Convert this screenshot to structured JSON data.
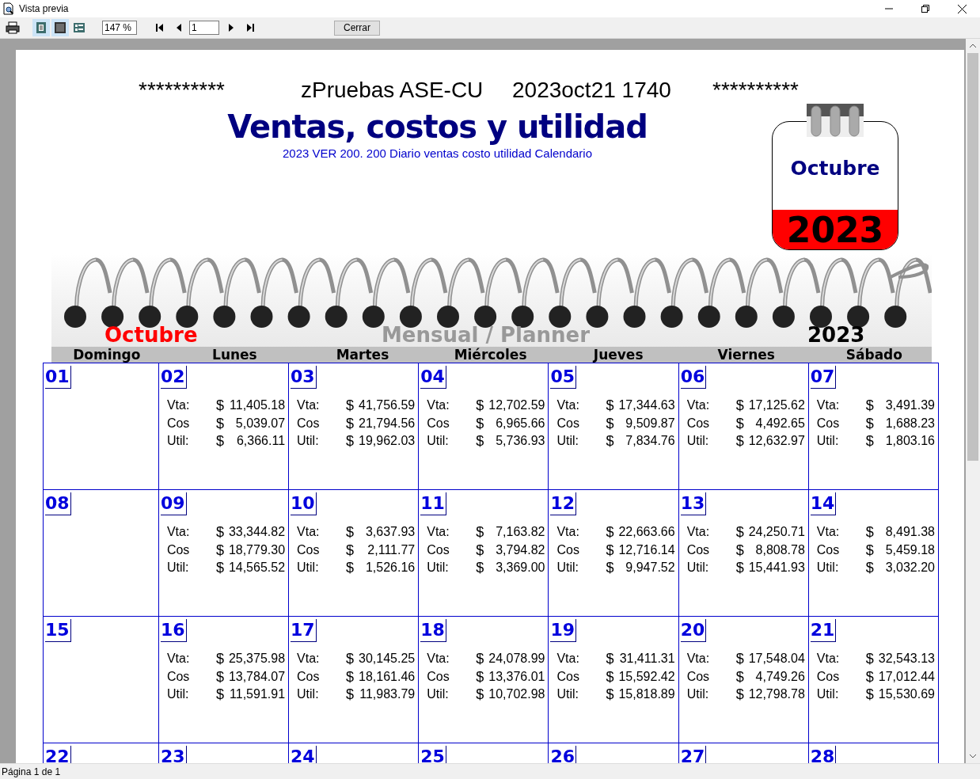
{
  "window": {
    "title": "Vista previa"
  },
  "toolbar": {
    "views": [
      {
        "selected": true
      },
      {
        "selected": true
      },
      {
        "selected": false
      }
    ],
    "zoom": "147 %",
    "page": "1",
    "close_button": "Cerrar"
  },
  "report": {
    "header": [
      "**********",
      "zPruebas ASE-CU",
      "2023oct21 1740",
      "**********"
    ],
    "title": "Ventas, costos y utilidad",
    "subtitle": "2023 VER 200. 200 Diario ventas costo utilidad Calendario",
    "badge": {
      "month": "Octubre",
      "year": "2023"
    },
    "banner": {
      "month": "Octubre",
      "subtitle": "Mensual / Planner",
      "year": "2023"
    },
    "weekdays": [
      "Domingo",
      "Lunes",
      "Martes",
      "Miércoles",
      "Jueves",
      "Viernes",
      "Sábado"
    ],
    "weeks": [
      [
        {
          "day": "01"
        },
        {
          "day": "02",
          "lines": [
            {
              "label": "Vta:",
              "currency": "$",
              "amount": "11,405.18"
            },
            {
              "label": "Cos",
              "currency": "$",
              "amount": "5,039.07"
            },
            {
              "label": "Util:",
              "currency": "$",
              "amount": "6,366.11"
            }
          ]
        },
        {
          "day": "03",
          "lines": [
            {
              "label": "Vta:",
              "currency": "$",
              "amount": "41,756.59"
            },
            {
              "label": "Cos",
              "currency": "$",
              "amount": "21,794.56"
            },
            {
              "label": "Util:",
              "currency": "$",
              "amount": "19,962.03"
            }
          ]
        },
        {
          "day": "04",
          "lines": [
            {
              "label": "Vta:",
              "currency": "$",
              "amount": "12,702.59"
            },
            {
              "label": "Cos",
              "currency": "$",
              "amount": "6,965.66"
            },
            {
              "label": "Util:",
              "currency": "$",
              "amount": "5,736.93"
            }
          ]
        },
        {
          "day": "05",
          "lines": [
            {
              "label": "Vta:",
              "currency": "$",
              "amount": "17,344.63"
            },
            {
              "label": "Cos",
              "currency": "$",
              "amount": "9,509.87"
            },
            {
              "label": "Util:",
              "currency": "$",
              "amount": "7,834.76"
            }
          ]
        },
        {
          "day": "06",
          "lines": [
            {
              "label": "Vta:",
              "currency": "$",
              "amount": "17,125.62"
            },
            {
              "label": "Cos",
              "currency": "$",
              "amount": "4,492.65"
            },
            {
              "label": "Util:",
              "currency": "$",
              "amount": "12,632.97"
            }
          ]
        },
        {
          "day": "07",
          "lines": [
            {
              "label": "Vta:",
              "currency": "$",
              "amount": "3,491.39"
            },
            {
              "label": "Cos",
              "currency": "$",
              "amount": "1,688.23"
            },
            {
              "label": "Util:",
              "currency": "$",
              "amount": "1,803.16"
            }
          ]
        }
      ],
      [
        {
          "day": "08"
        },
        {
          "day": "09",
          "lines": [
            {
              "label": "Vta:",
              "currency": "$",
              "amount": "33,344.82"
            },
            {
              "label": "Cos",
              "currency": "$",
              "amount": "18,779.30"
            },
            {
              "label": "Util:",
              "currency": "$",
              "amount": "14,565.52"
            }
          ]
        },
        {
          "day": "10",
          "lines": [
            {
              "label": "Vta:",
              "currency": "$",
              "amount": "3,637.93"
            },
            {
              "label": "Cos",
              "currency": "$",
              "amount": "2,111.77"
            },
            {
              "label": "Util:",
              "currency": "$",
              "amount": "1,526.16"
            }
          ]
        },
        {
          "day": "11",
          "lines": [
            {
              "label": "Vta:",
              "currency": "$",
              "amount": "7,163.82"
            },
            {
              "label": "Cos",
              "currency": "$",
              "amount": "3,794.82"
            },
            {
              "label": "Util:",
              "currency": "$",
              "amount": "3,369.00"
            }
          ]
        },
        {
          "day": "12",
          "lines": [
            {
              "label": "Vta:",
              "currency": "$",
              "amount": "22,663.66"
            },
            {
              "label": "Cos",
              "currency": "$",
              "amount": "12,716.14"
            },
            {
              "label": "Util:",
              "currency": "$",
              "amount": "9,947.52"
            }
          ]
        },
        {
          "day": "13",
          "lines": [
            {
              "label": "Vta:",
              "currency": "$",
              "amount": "24,250.71"
            },
            {
              "label": "Cos",
              "currency": "$",
              "amount": "8,808.78"
            },
            {
              "label": "Util:",
              "currency": "$",
              "amount": "15,441.93"
            }
          ]
        },
        {
          "day": "14",
          "lines": [
            {
              "label": "Vta:",
              "currency": "$",
              "amount": "8,491.38"
            },
            {
              "label": "Cos",
              "currency": "$",
              "amount": "5,459.18"
            },
            {
              "label": "Util:",
              "currency": "$",
              "amount": "3,032.20"
            }
          ]
        }
      ],
      [
        {
          "day": "15"
        },
        {
          "day": "16",
          "lines": [
            {
              "label": "Vta:",
              "currency": "$",
              "amount": "25,375.98"
            },
            {
              "label": "Cos",
              "currency": "$",
              "amount": "13,784.07"
            },
            {
              "label": "Util:",
              "currency": "$",
              "amount": "11,591.91"
            }
          ]
        },
        {
          "day": "17",
          "lines": [
            {
              "label": "Vta:",
              "currency": "$",
              "amount": "30,145.25"
            },
            {
              "label": "Cos",
              "currency": "$",
              "amount": "18,161.46"
            },
            {
              "label": "Util:",
              "currency": "$",
              "amount": "11,983.79"
            }
          ]
        },
        {
          "day": "18",
          "lines": [
            {
              "label": "Vta:",
              "currency": "$",
              "amount": "24,078.99"
            },
            {
              "label": "Cos",
              "currency": "$",
              "amount": "13,376.01"
            },
            {
              "label": "Util:",
              "currency": "$",
              "amount": "10,702.98"
            }
          ]
        },
        {
          "day": "19",
          "lines": [
            {
              "label": "Vta:",
              "currency": "$",
              "amount": "31,411.31"
            },
            {
              "label": "Cos",
              "currency": "$",
              "amount": "15,592.42"
            },
            {
              "label": "Util:",
              "currency": "$",
              "amount": "15,818.89"
            }
          ]
        },
        {
          "day": "20",
          "lines": [
            {
              "label": "Vta:",
              "currency": "$",
              "amount": "17,548.04"
            },
            {
              "label": "Cos",
              "currency": "$",
              "amount": "4,749.26"
            },
            {
              "label": "Util:",
              "currency": "$",
              "amount": "12,798.78"
            }
          ]
        },
        {
          "day": "21",
          "lines": [
            {
              "label": "Vta:",
              "currency": "$",
              "amount": "32,543.13"
            },
            {
              "label": "Cos",
              "currency": "$",
              "amount": "17,012.44"
            },
            {
              "label": "Util:",
              "currency": "$",
              "amount": "15,530.69"
            }
          ]
        }
      ],
      [
        {
          "day": "22"
        },
        {
          "day": "23"
        },
        {
          "day": "24"
        },
        {
          "day": "25"
        },
        {
          "day": "26"
        },
        {
          "day": "27"
        },
        {
          "day": "28"
        }
      ]
    ]
  },
  "status_bar": "Página 1 de 1"
}
